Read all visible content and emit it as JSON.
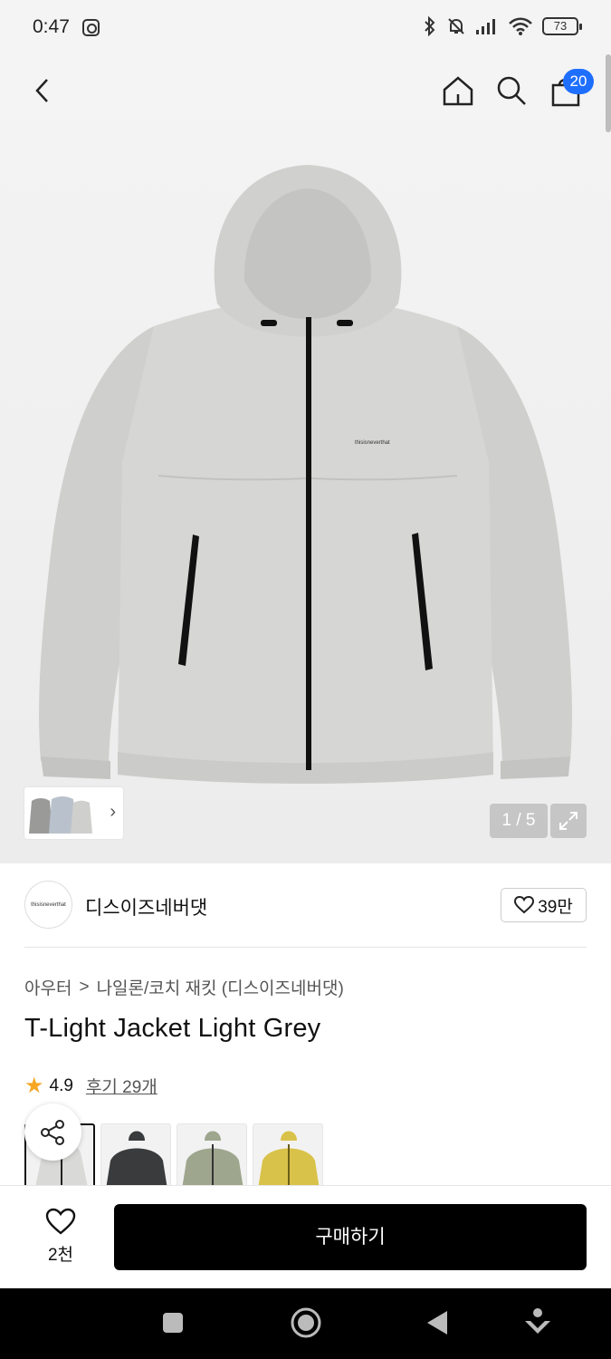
{
  "status_bar": {
    "time": "0:47",
    "battery": "73"
  },
  "header": {
    "cart_count": "20"
  },
  "gallery": {
    "pager": "1 / 5"
  },
  "brand": {
    "logo_text": "thisisneverthat",
    "name": "디스이즈네버댓",
    "likes": "39만"
  },
  "breadcrumb": {
    "level1": "아우터",
    "separator": ">",
    "level2": "나일론/코치 재킷 (디스이즈네버댓)"
  },
  "product": {
    "title": "T-Light Jacket Light Grey",
    "rating": "4.9",
    "reviews": "후기 29개"
  },
  "swatches": [
    {
      "name": "light-grey",
      "color": "#d9d9d7"
    },
    {
      "name": "black",
      "color": "#3a3b3d"
    },
    {
      "name": "sage",
      "color": "#9ea68e"
    },
    {
      "name": "yellow",
      "color": "#d9c24a"
    }
  ],
  "bottom_bar": {
    "wish_count": "2천",
    "buy_label": "구매하기"
  },
  "colors": {
    "accent_badge": "#1f6fff",
    "buy_button": "#000000",
    "star": "#f5a623"
  }
}
